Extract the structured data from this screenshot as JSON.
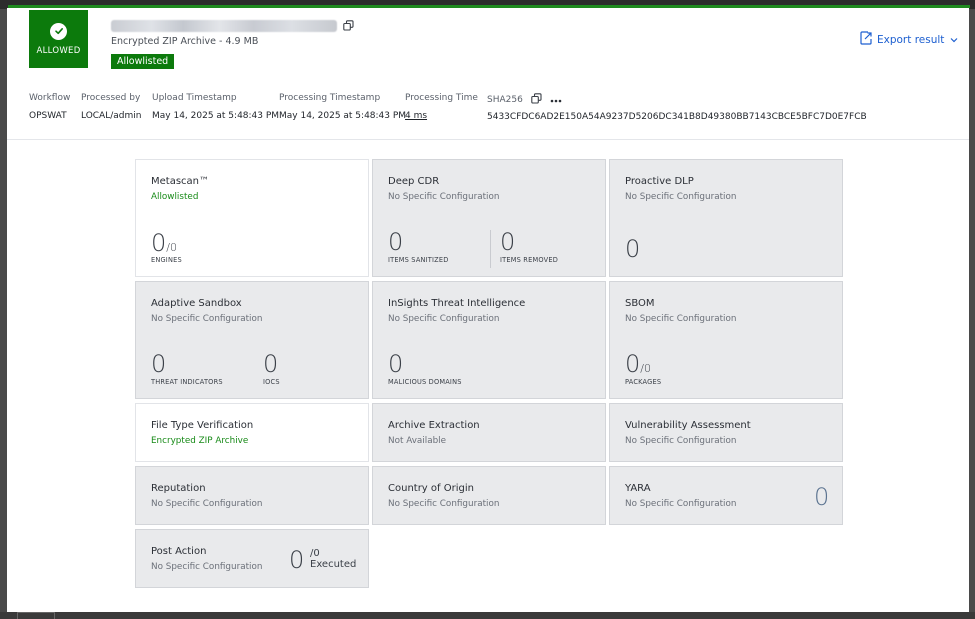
{
  "verdict": {
    "label": "ALLOWED",
    "color": "#0c7a0c",
    "icon": "check-circle-icon"
  },
  "file": {
    "subtitle": "Encrypted ZIP Archive - 4.9 MB",
    "badge": "Allowlisted"
  },
  "export": {
    "label": "Export result"
  },
  "meta": {
    "workflow": {
      "label": "Workflow",
      "value": "OPSWAT"
    },
    "processed_by": {
      "label": "Processed by",
      "value": "LOCAL/admin"
    },
    "upload_ts": {
      "label": "Upload Timestamp",
      "value": "May 14, 2025 at 5:48:43 PM"
    },
    "processing_ts": {
      "label": "Processing Timestamp",
      "value": "May 14, 2025 at 5:48:43 PM"
    },
    "processing_time": {
      "label": "Processing Time",
      "value": "4 ms"
    },
    "sha256": {
      "label": "SHA256",
      "value": "5433CFDC6AD2E150A54A9237D5206DC341B8D49380BB7143CBCE5BFC7D0E7FCB"
    }
  },
  "cards": {
    "metascan": {
      "title": "Metascan™",
      "status": "Allowlisted",
      "value": "0",
      "total": "/0",
      "caption": "ENGINES"
    },
    "deep_cdr": {
      "title": "Deep CDR",
      "status": "No Specific Configuration",
      "sanitized": "0",
      "sanitized_caption": "ITEMS SANITIZED",
      "removed": "0",
      "removed_caption": "ITEMS REMOVED"
    },
    "proactive_dlp": {
      "title": "Proactive DLP",
      "status": "No Specific Configuration",
      "value": "0"
    },
    "adaptive_sandbox": {
      "title": "Adaptive Sandbox",
      "status": "No Specific Configuration",
      "threat_indicators": "0",
      "threat_caption": "THREAT INDICATORS",
      "iocs": "0",
      "iocs_caption": "IOCS"
    },
    "insights": {
      "title": "InSights Threat Intelligence",
      "status": "No Specific Configuration",
      "value": "0",
      "caption": "MALICIOUS DOMAINS"
    },
    "sbom": {
      "title": "SBOM",
      "status": "No Specific Configuration",
      "value": "0",
      "total": "/0",
      "caption": "PACKAGES"
    },
    "file_type": {
      "title": "File Type Verification",
      "status": "Encrypted ZIP Archive"
    },
    "archive": {
      "title": "Archive Extraction",
      "status": "Not Available"
    },
    "vulnerability": {
      "title": "Vulnerability Assessment",
      "status": "No Specific Configuration"
    },
    "reputation": {
      "title": "Reputation",
      "status": "No Specific Configuration"
    },
    "country": {
      "title": "Country of Origin",
      "status": "No Specific Configuration"
    },
    "yara": {
      "title": "YARA",
      "status": "No Specific Configuration",
      "value": "0"
    },
    "post_action": {
      "title": "Post Action",
      "status": "No Specific Configuration",
      "value": "0",
      "total": "/0",
      "executed": "Executed"
    }
  }
}
